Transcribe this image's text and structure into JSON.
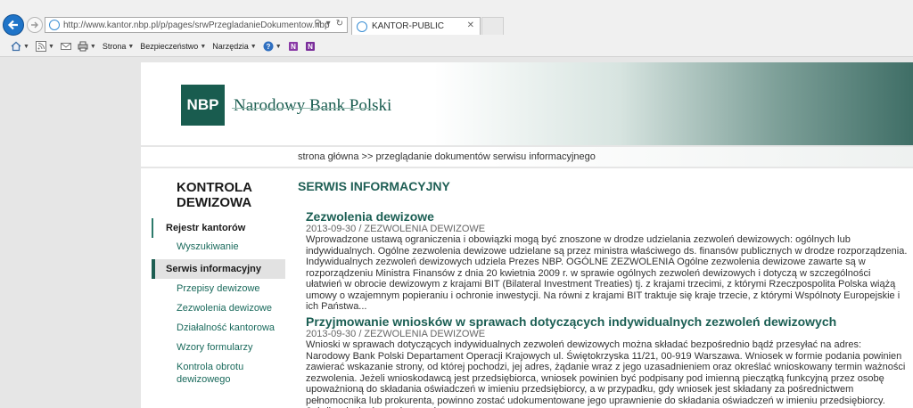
{
  "browser": {
    "url": "http://www.kantor.nbp.pl/p/pages/srwPrzegladanieDokumentow.nbp",
    "tab_title": "KANTOR-PUBLIC",
    "commands": {
      "page": "Strona",
      "security": "Bezpieczeństwo",
      "tools": "Narzędzia"
    }
  },
  "header": {
    "logo_abbr": "NBP",
    "logo_name": "Narodowy Bank Polski"
  },
  "breadcrumb": "strona główna >> przeglądanie dokumentów serwisu informacyjnego",
  "sidebar": {
    "title": "KONTROLA DEWIZOWA",
    "items": [
      {
        "label": "Rejestr kantorów"
      },
      {
        "label": "Wyszukiwanie"
      },
      {
        "label": "Serwis informacyjny"
      },
      {
        "label": "Przepisy dewizowe"
      },
      {
        "label": "Zezwolenia dewizowe"
      },
      {
        "label": "Działalność kantorowa"
      },
      {
        "label": "Wzory formularzy"
      },
      {
        "label": "Kontrola obrotu dewizowego"
      }
    ]
  },
  "main": {
    "title": "SERWIS INFORMACYJNY",
    "articles": [
      {
        "title": "Zezwolenia dewizowe",
        "meta": "2013-09-30 / ZEZWOLENIA DEWIZOWE",
        "body": "Wprowadzone ustawą ograniczenia i obowiązki mogą być znoszone w drodze udzielania zezwoleń dewizowych: ogólnych lub indywidualnych. Ogólne zezwolenia dewizowe udzielane są przez ministra właściwego ds. finansów publicznych w drodze rozporządzenia. Indywidualnych zezwoleń dewizowych udziela Prezes NBP. OGÓLNE ZEZWOLENIA Ogólne zezwolenia dewizowe zawarte są w rozporządzeniu Ministra Finansów z dnia 20 kwietnia 2009 r. w sprawie ogólnych zezwoleń dewizowych i dotyczą w szczególności ułatwień w obrocie dewizowym z krajami BIT (Bilateral Investment Treaties) tj. z krajami trzecimi, z którymi Rzeczpospolita Polska wiążą umowy o wzajemnym popieraniu i ochronie inwestycji. Na równi z krajami BIT traktuje się kraje trzecie, z którymi Wspólnoty Europejskie i ich Państwa..."
      },
      {
        "title": "Przyjmowanie wniosków w sprawach dotyczących indywidualnych zezwoleń dewizowych",
        "meta": "2013-09-30 / ZEZWOLENIA DEWIZOWE",
        "body": "Wnioski w sprawach dotyczących indywidualnych zezwoleń dewizowych można składać bezpośrednio bądź przesyłać na adres: Narodowy Bank Polski Departament Operacji Krajowych ul. Świętokrzyska 11/21, 00-919 Warszawa. Wniosek w formie podania powinien zawierać wskazanie strony, od której pochodzi, jej adres, żądanie wraz z jego uzasadnieniem oraz określać wnioskowany termin ważności zezwolenia. Jeżeli wnioskodawcą jest przedsiębiorca, wniosek powinien być podpisany pod imienną pieczątką funkcyjną przez osobę upoważnioną do składania oświadczeń w imieniu przedsiębiorcy, a w przypadku, gdy wniosek jest składany za pośrednictwem pełnomocnika lub prokurenta, powinno zostać udokumentowane jego uprawnienie do składania oświadczeń w imieniu przedsiębiorcy. Jeżeli wnioskodawcą jest osoba..."
      }
    ]
  }
}
